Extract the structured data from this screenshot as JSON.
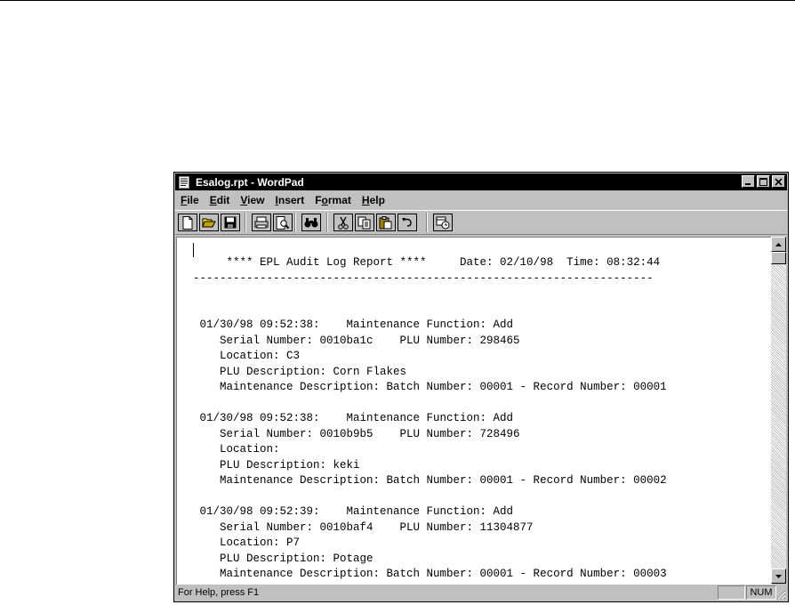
{
  "window": {
    "title": "Esalog.rpt - WordPad",
    "controls": [
      "minimize",
      "maximize",
      "close"
    ]
  },
  "menu": [
    {
      "label": "File",
      "key": "F",
      "rest": "ile"
    },
    {
      "label": "Edit",
      "key": "E",
      "rest": "dit"
    },
    {
      "label": "View",
      "key": "V",
      "rest": "iew"
    },
    {
      "label": "Insert",
      "key": "I",
      "rest": "nsert"
    },
    {
      "label": "Format",
      "key": "o",
      "pre": "F",
      "rest": "rmat"
    },
    {
      "label": "Help",
      "key": "H",
      "rest": "elp"
    }
  ],
  "toolbar": {
    "buttons": [
      "new-icon",
      "open-icon",
      "save-icon",
      "print-icon",
      "print-preview-icon",
      "find-icon",
      "cut-icon",
      "copy-icon",
      "paste-icon",
      "undo-icon",
      "date-time-icon"
    ]
  },
  "document": {
    "lines": [
      "     **** EPL Audit Log Report ****     Date: 02/10/98  Time: 08:32:44",
      "---------------------------------------------------------------------",
      "",
      "",
      " 01/30/98 09:52:38:    Maintenance Function: Add",
      "    Serial Number: 0010ba1c    PLU Number: 298465",
      "    Location: C3",
      "    PLU Description: Corn Flakes",
      "    Maintenance Description: Batch Number: 00001 - Record Number: 00001",
      "",
      " 01/30/98 09:52:38:    Maintenance Function: Add",
      "    Serial Number: 0010b9b5    PLU Number: 728496",
      "    Location:",
      "    PLU Description: keki",
      "    Maintenance Description: Batch Number: 00001 - Record Number: 00002",
      "",
      " 01/30/98 09:52:39:    Maintenance Function: Add",
      "    Serial Number: 0010baf4    PLU Number: 11304877",
      "    Location: P7",
      "    PLU Description: Potage",
      "    Maintenance Description: Batch Number: 00001 - Record Number: 00003"
    ]
  },
  "status": {
    "help_text": "For Help, press F1",
    "num_indicator": "NUM"
  }
}
